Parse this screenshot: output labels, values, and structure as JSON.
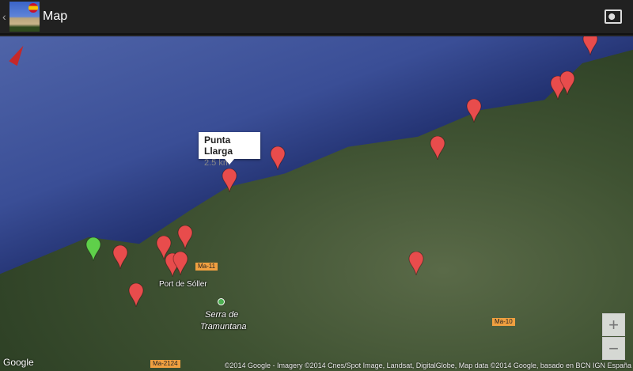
{
  "header": {
    "title": "Map",
    "back_icon": "chevron-left-icon",
    "world_icon": "world-map-icon"
  },
  "map": {
    "callout": {
      "title": "Punta Llarga",
      "subtitle": "2.5 km"
    },
    "labels": {
      "town": "Port de Sóller",
      "mountain_1": "Serra de",
      "mountain_2": "Tramuntana"
    },
    "roads": [
      "Ma-11",
      "Ma-10",
      "Ma-2124"
    ],
    "zoom_in": "+",
    "zoom_out": "−",
    "logo": "Google",
    "attribution": "©2014 Google - Imagery ©2014 Cnes/Spot Image, Landsat, DigitalGlobe, Map data ©2014 Google, basado en BCN IGN España",
    "colors": {
      "marker_red": "#e84c4c",
      "marker_green": "#5fd04a"
    }
  }
}
